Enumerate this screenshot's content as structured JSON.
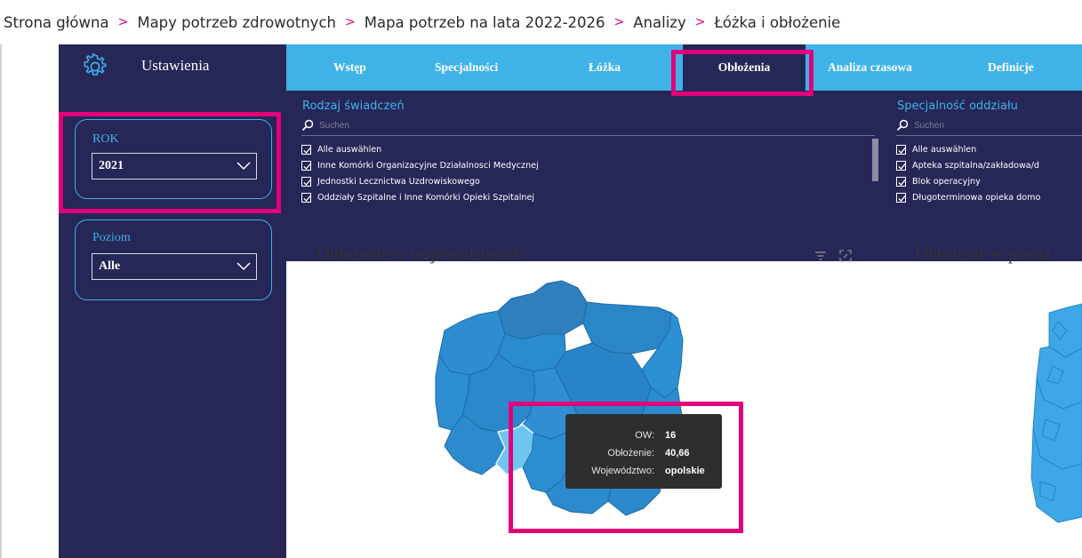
{
  "breadcrumb": {
    "items": [
      "Strona główna",
      "Mapy potrzeb zdrowotnych",
      "Mapa potrzeb na lata 2022-2026",
      "Analizy",
      "Łóżka i obłożenie"
    ],
    "separator": ">"
  },
  "sidebar": {
    "settings_label": "Ustawienia",
    "filters": [
      {
        "title": "ROK",
        "value": "2021"
      },
      {
        "title": "Poziom",
        "value": "Alle"
      }
    ]
  },
  "tabs": [
    {
      "label": "Wstęp",
      "active": false
    },
    {
      "label": "Specjalności",
      "active": false
    },
    {
      "label": "Łóżka",
      "active": false
    },
    {
      "label": "Obłożenia",
      "active": true
    },
    {
      "label": "Analiza czasowa",
      "active": false
    },
    {
      "label": "Definicje",
      "active": false
    }
  ],
  "slicers": [
    {
      "title": "Rodzaj świadczeń",
      "search_placeholder": "Suchen",
      "items": [
        "Alle auswählen",
        "Inne Komórki Organizacyjne Działalnosci Medycznej",
        "Jednostki Lecznictwa Uzdrowiskowego",
        "Oddziały Szpitalne i Inne Komórki Opieki Szpitalnej"
      ]
    },
    {
      "title": "Specjalność oddziału",
      "search_placeholder": "Suchen",
      "items": [
        "Alle auswählen",
        "Apteka szpitalna/zakładowa/d",
        "Blok operacyjny",
        "Długoterminowa opieka domo"
      ]
    }
  ],
  "visuals": [
    {
      "title": "Obłożenie w województwach"
    },
    {
      "title": "Obłożenie w powia"
    }
  ],
  "tooltip": {
    "rows": [
      {
        "key": "OW:",
        "value": "16"
      },
      {
        "key": "Obłożenie:",
        "value": "40,66"
      },
      {
        "key": "Województwo:",
        "value": "opolskie"
      }
    ]
  },
  "colors": {
    "sidebar": "#262657",
    "accent": "#3fb3e8",
    "highlight": "#e2007a",
    "map_fill": "#2a8ccf",
    "map_selected": "#6dc5f1",
    "tooltip_bg": "#2e2e2e"
  }
}
